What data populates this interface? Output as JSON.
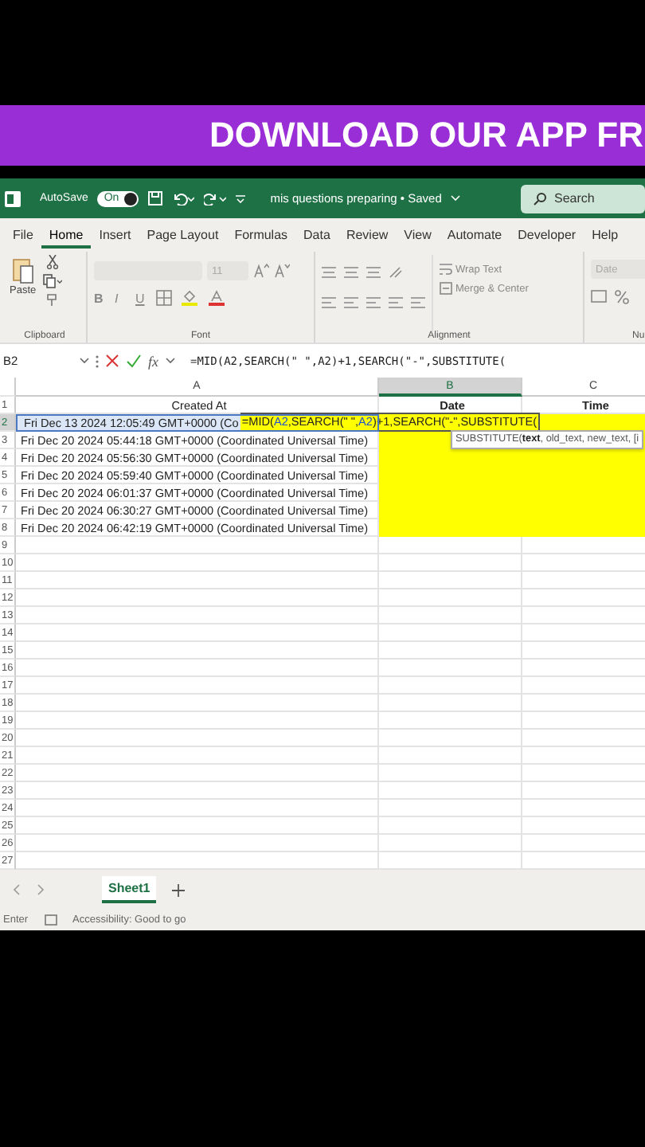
{
  "banner": {
    "text": "DOWNLOAD OUR APP FR"
  },
  "title_bar": {
    "autosave_label": "AutoSave",
    "autosave_toggle": {
      "label": "On",
      "on": true
    },
    "document_title": "mis questions preparing • Saved",
    "search_placeholder": "Search"
  },
  "ribbon_tabs": [
    {
      "label": "File",
      "selected": false
    },
    {
      "label": "Home",
      "selected": true
    },
    {
      "label": "Insert",
      "selected": false
    },
    {
      "label": "Page Layout",
      "selected": false
    },
    {
      "label": "Formulas",
      "selected": false
    },
    {
      "label": "Data",
      "selected": false
    },
    {
      "label": "Review",
      "selected": false
    },
    {
      "label": "View",
      "selected": false
    },
    {
      "label": "Automate",
      "selected": false
    },
    {
      "label": "Developer",
      "selected": false
    },
    {
      "label": "Help",
      "selected": false
    }
  ],
  "ribbon": {
    "clipboard": {
      "paste": "Paste",
      "label": "Clipboard"
    },
    "font": {
      "size": "11",
      "buttons": [
        "B",
        "I",
        "U"
      ],
      "label": "Font"
    },
    "alignment": {
      "wrap": "Wrap Text",
      "merge": "Merge & Center",
      "label": "Alignment"
    },
    "number": {
      "format": "Date",
      "label": "Nu"
    }
  },
  "formula_bar": {
    "name_box": "B2",
    "function_label": "fx",
    "formula": "=MID(A2,SEARCH(\" \",A2)+1,SEARCH(\"-\",SUBSTITUTE("
  },
  "columns": [
    {
      "label": "A",
      "selected": false
    },
    {
      "label": "B",
      "selected": true
    },
    {
      "label": "C",
      "selected": false
    }
  ],
  "rows": [
    {
      "number": "1",
      "selected": false,
      "referenced": false,
      "highlighted": false,
      "cells": [
        "Created At",
        "Date",
        "Time"
      ]
    },
    {
      "number": "2",
      "selected": true,
      "referenced": true,
      "highlighted": true,
      "cells": [
        "Fri Dec 13 2024 12:05:49 GMT+0000 (Co"
      ],
      "editor": [
        {
          "text": "=MID(",
          "kind": "plain"
        },
        {
          "text": "A2",
          "kind": "reference"
        },
        {
          "text": ",SEARCH(\" \",",
          "kind": "plain"
        },
        {
          "text": "A2",
          "kind": "reference"
        },
        {
          "text": ")+1,SEARCH(\"-\",SUBSTITUTE(",
          "kind": "plain"
        }
      ],
      "tooltip": "SUBSTITUTE(**text**, old_text, new_text, [i"
    },
    {
      "number": "3",
      "selected": false,
      "referenced": false,
      "highlighted": true,
      "cells": [
        "Fri Dec 20 2024 05:44:18 GMT+0000 (Coordinated Universal Time)"
      ]
    },
    {
      "number": "4",
      "selected": false,
      "referenced": false,
      "highlighted": true,
      "cells": [
        "Fri Dec 20 2024 05:56:30 GMT+0000 (Coordinated Universal Time)"
      ]
    },
    {
      "number": "5",
      "selected": false,
      "referenced": false,
      "highlighted": true,
      "cells": [
        "Fri Dec 20 2024 05:59:40 GMT+0000 (Coordinated Universal Time)"
      ]
    },
    {
      "number": "6",
      "selected": false,
      "referenced": false,
      "highlighted": true,
      "cells": [
        "Fri Dec 20 2024 06:01:37 GMT+0000 (Coordinated Universal Time)"
      ]
    },
    {
      "number": "7",
      "selected": false,
      "referenced": false,
      "highlighted": true,
      "cells": [
        "Fri Dec 20 2024 06:30:27 GMT+0000 (Coordinated Universal Time)"
      ]
    },
    {
      "number": "8",
      "selected": false,
      "referenced": false,
      "highlighted": true,
      "cells": [
        "Fri Dec 20 2024 06:42:19 GMT+0000 (Coordinated Universal Time)"
      ]
    },
    {
      "number": "9",
      "selected": false,
      "referenced": false,
      "highlighted": false
    },
    {
      "number": "10",
      "selected": false,
      "referenced": false,
      "highlighted": false
    },
    {
      "number": "11",
      "selected": false,
      "referenced": false,
      "highlighted": false
    },
    {
      "number": "12",
      "selected": false,
      "referenced": false,
      "highlighted": false
    },
    {
      "number": "13",
      "selected": false,
      "referenced": false,
      "highlighted": false
    },
    {
      "number": "14",
      "selected": false,
      "referenced": false,
      "highlighted": false
    },
    {
      "number": "15",
      "selected": false,
      "referenced": false,
      "highlighted": false
    },
    {
      "number": "16",
      "selected": false,
      "referenced": false,
      "highlighted": false
    },
    {
      "number": "17",
      "selected": false,
      "referenced": false,
      "highlighted": false
    },
    {
      "number": "18",
      "selected": false,
      "referenced": false,
      "highlighted": false
    },
    {
      "number": "19",
      "selected": false,
      "referenced": false,
      "highlighted": false
    },
    {
      "number": "20",
      "selected": false,
      "referenced": false,
      "highlighted": false
    },
    {
      "number": "21",
      "selected": false,
      "referenced": false,
      "highlighted": false
    },
    {
      "number": "22",
      "selected": false,
      "referenced": false,
      "highlighted": false
    },
    {
      "number": "23",
      "selected": false,
      "referenced": false,
      "highlighted": false
    },
    {
      "number": "24",
      "selected": false,
      "referenced": false,
      "highlighted": false
    },
    {
      "number": "25",
      "selected": false,
      "referenced": false,
      "highlighted": false
    },
    {
      "number": "26",
      "selected": false,
      "referenced": false,
      "highlighted": false
    },
    {
      "number": "27",
      "selected": false,
      "referenced": false,
      "highlighted": false
    }
  ],
  "sheet_tabs": [
    {
      "label": "Sheet1",
      "selected": true
    }
  ],
  "status_bar": {
    "mode": "Enter",
    "accessibility": "Accessibility: Good to go"
  }
}
